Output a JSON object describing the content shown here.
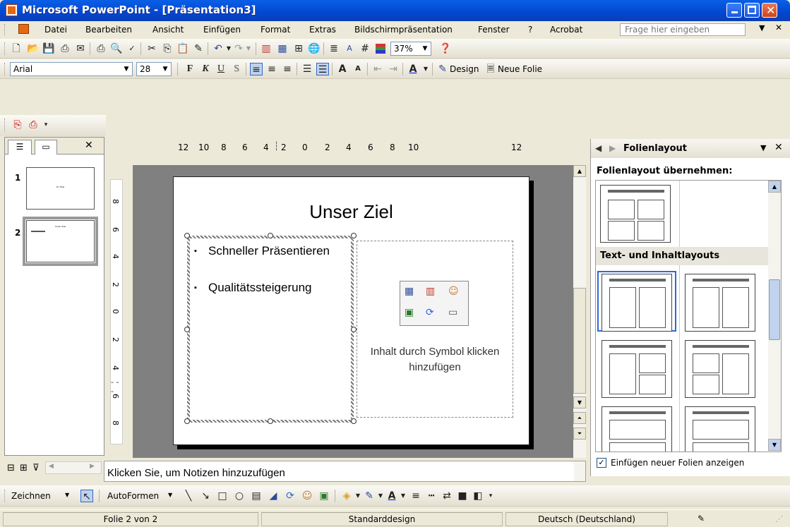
{
  "window": {
    "title": "Microsoft PowerPoint - [Präsentation3]"
  },
  "menubar": {
    "items": [
      "Datei",
      "Bearbeiten",
      "Ansicht",
      "Einfügen",
      "Format",
      "Extras",
      "Bildschirmpräsentation",
      "Fenster",
      "?",
      "Acrobat"
    ],
    "help_placeholder": "Frage hier eingeben",
    "close_glyph": "✕"
  },
  "standard_toolbar": {
    "zoom": "37%"
  },
  "format_toolbar": {
    "font": "Arial",
    "size": "28",
    "bold": "F",
    "italic": "K",
    "underline": "U",
    "shadow": "S",
    "design_label": "Design",
    "new_slide_label": "Neue Folie"
  },
  "left_panel": {
    "slides": [
      {
        "number": "1",
        "mini_title": "Ihr Titel"
      },
      {
        "number": "2",
        "mini_title": "Unser Ziel"
      }
    ]
  },
  "ruler": {
    "h_ticks": [
      "12",
      "10",
      "8",
      "6",
      "4",
      "2",
      "0",
      "2",
      "4",
      "6",
      "8",
      "10",
      "12"
    ],
    "v_ticks": [
      "8",
      "6",
      "4",
      "2",
      "0",
      "2",
      "4",
      "6",
      "8"
    ]
  },
  "slide": {
    "title": "Unser Ziel",
    "bullets": [
      "Schneller Präsentieren",
      "Qualitätssteigerung"
    ],
    "content_hint": "Inhalt durch Symbol klicken hinzufügen"
  },
  "task_pane": {
    "title": "Folienlayout",
    "apply_label": "Folienlayout übernehmen:",
    "section_label": "Text- und Inhaltlayouts",
    "checkbox_label": "Einfügen neuer Folien anzeigen",
    "checkbox_checked": true
  },
  "notes": {
    "placeholder": "Klicken Sie, um Notizen hinzuzufügen"
  },
  "drawing_toolbar": {
    "draw_label": "Zeichnen",
    "autoshapes_label": "AutoFormen"
  },
  "statusbar": {
    "slide_info": "Folie 2 von 2",
    "design": "Standarddesign",
    "language": "Deutsch (Deutschland)"
  }
}
